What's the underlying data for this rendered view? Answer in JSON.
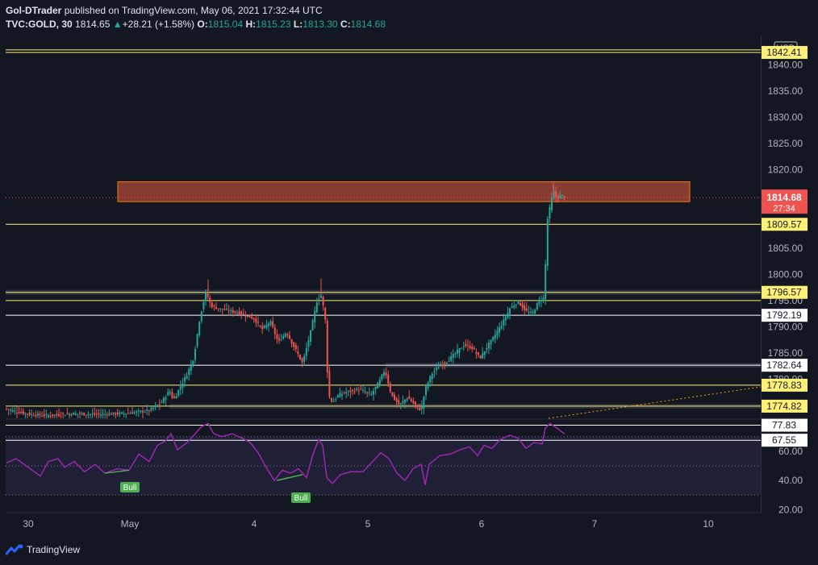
{
  "header": {
    "publisher": "Gol-DTrader",
    "published_text": "published on TradingView.com, May 06, 2021 17:32:44 UTC",
    "symbol": "TVC:GOLD, 30",
    "last": "1814.65",
    "change_arrow": "▲",
    "change": "+28.21 (+1.58%)",
    "open_label": "O:",
    "open": "1815.04",
    "high_label": "H:",
    "high": "1815.23",
    "low_label": "L:",
    "low": "1813.30",
    "close_label": "C:",
    "close": "1814.68"
  },
  "brand": {
    "name": "TradingView",
    "icon": "tradingview-logo-icon"
  },
  "colors": {
    "background": "#131722",
    "up": "#26a69a",
    "down": "#ef5350",
    "level_yellow": "#fff176",
    "level_white": "#ffffff",
    "rsi": "#9c27b0",
    "zone_fill": "#e65b3c",
    "last_price": "#ef5350"
  },
  "chart_data": [
    {
      "type": "candlestick",
      "currency_label": "USD",
      "y_ticks": [
        "1840.00",
        "1835.00",
        "1830.00",
        "1825.00",
        "1820.00",
        "1805.00",
        "1800.00",
        "1795.00",
        "1790.00",
        "1785.00",
        "1780.00"
      ],
      "y_range": [
        1772.5,
        1845.5
      ],
      "x_ticks": [
        "30",
        "May",
        "4",
        "5",
        "6",
        "7",
        "10"
      ],
      "last_price": {
        "value": "1814.68",
        "countdown": "27:34"
      },
      "levels": [
        {
          "value": 1842.41,
          "label": "1842.41",
          "color": "yellow"
        },
        {
          "value": 1809.57,
          "label": "1809.57",
          "color": "yellow"
        },
        {
          "value": 1796.57,
          "label": "1796.57",
          "color": "yellow"
        },
        {
          "value": 1792.19,
          "label": "1792.19",
          "color": "white"
        },
        {
          "value": 1782.64,
          "label": "1782.64",
          "color": "white"
        },
        {
          "value": 1778.83,
          "label": "1778.83",
          "color": "yellow"
        },
        {
          "value": 1774.82,
          "label": "1774.82",
          "color": "yellow"
        }
      ],
      "resistance_zone": [
        1813.9,
        1817.7
      ],
      "price_path": [
        [
          0,
          1774.6
        ],
        [
          10,
          1774.2
        ],
        [
          20,
          1773.8
        ],
        [
          40,
          1773.2
        ],
        [
          60,
          1773.0
        ],
        [
          90,
          1773.4
        ],
        [
          120,
          1773.2
        ],
        [
          160,
          1773.5
        ],
        [
          185,
          1774.0
        ],
        [
          200,
          1775.5
        ],
        [
          210,
          1777.8
        ],
        [
          215,
          1776.0
        ],
        [
          225,
          1779.0
        ],
        [
          232,
          1781.0
        ],
        [
          240,
          1784.0
        ],
        [
          248,
          1792.0
        ],
        [
          255,
          1796.5
        ],
        [
          262,
          1794.0
        ],
        [
          270,
          1793.5
        ],
        [
          285,
          1793.0
        ],
        [
          300,
          1792.5
        ],
        [
          315,
          1791.5
        ],
        [
          325,
          1789.5
        ],
        [
          335,
          1791.0
        ],
        [
          345,
          1787.0
        ],
        [
          355,
          1789.0
        ],
        [
          365,
          1786.0
        ],
        [
          375,
          1783.0
        ],
        [
          385,
          1789.0
        ],
        [
          393,
          1795.0
        ],
        [
          398,
          1796.0
        ],
        [
          403,
          1792.0
        ],
        [
          407,
          1777.0
        ],
        [
          412,
          1775.5
        ],
        [
          420,
          1777.0
        ],
        [
          430,
          1777.5
        ],
        [
          445,
          1778.0
        ],
        [
          460,
          1777.0
        ],
        [
          470,
          1779.5
        ],
        [
          477,
          1781.8
        ],
        [
          485,
          1777.0
        ],
        [
          495,
          1775.0
        ],
        [
          505,
          1776.5
        ],
        [
          515,
          1775.0
        ],
        [
          522,
          1774.0
        ],
        [
          527,
          1778.0
        ],
        [
          535,
          1781.0
        ],
        [
          545,
          1782.5
        ],
        [
          555,
          1783.5
        ],
        [
          565,
          1785.0
        ],
        [
          575,
          1786.5
        ],
        [
          585,
          1786.0
        ],
        [
          595,
          1784.0
        ],
        [
          603,
          1786.0
        ],
        [
          612,
          1788.0
        ],
        [
          622,
          1790.5
        ],
        [
          632,
          1793.5
        ],
        [
          642,
          1794.8
        ],
        [
          652,
          1793.0
        ],
        [
          660,
          1792.5
        ],
        [
          668,
          1795.0
        ],
        [
          674,
          1795.5
        ],
        [
          676,
          1801.0
        ],
        [
          678,
          1810.0
        ],
        [
          682,
          1813.0
        ],
        [
          686,
          1816.0
        ],
        [
          690,
          1814.5
        ],
        [
          696,
          1815.2
        ],
        [
          700,
          1814.68
        ]
      ],
      "dotted_trendline": "orange",
      "series": [
        {
          "name": "TVC:GOLD",
          "type": "candlestick"
        }
      ]
    },
    {
      "type": "line",
      "indicator": "RSI",
      "y_ticks": [
        "60.00",
        "40.00",
        "20.00"
      ],
      "y_range": [
        18,
        82
      ],
      "levels": [
        {
          "value": 77.83,
          "label": "77.83"
        },
        {
          "value": 67.55,
          "label": "67.55"
        }
      ],
      "band": [
        30,
        70
      ],
      "annotations": [
        "Bull",
        "Bull"
      ],
      "rsi_path": [
        [
          8,
          52
        ],
        [
          20,
          55
        ],
        [
          35,
          49
        ],
        [
          50,
          43
        ],
        [
          60,
          53
        ],
        [
          72,
          55
        ],
        [
          80,
          49
        ],
        [
          92,
          53
        ],
        [
          105,
          46
        ],
        [
          118,
          51
        ],
        [
          130,
          45
        ],
        [
          145,
          48
        ],
        [
          160,
          47
        ],
        [
          172,
          58
        ],
        [
          185,
          53
        ],
        [
          195,
          64
        ],
        [
          205,
          67
        ],
        [
          212,
          72
        ],
        [
          220,
          61
        ],
        [
          232,
          66
        ],
        [
          242,
          72
        ],
        [
          250,
          77
        ],
        [
          258,
          79
        ],
        [
          265,
          72
        ],
        [
          275,
          70
        ],
        [
          288,
          72
        ],
        [
          300,
          69
        ],
        [
          310,
          66
        ],
        [
          320,
          59
        ],
        [
          330,
          49
        ],
        [
          340,
          40
        ],
        [
          350,
          47
        ],
        [
          360,
          45
        ],
        [
          370,
          48
        ],
        [
          380,
          42
        ],
        [
          388,
          58
        ],
        [
          395,
          68
        ],
        [
          400,
          64
        ],
        [
          405,
          42
        ],
        [
          412,
          38
        ],
        [
          422,
          44
        ],
        [
          435,
          46
        ],
        [
          450,
          46
        ],
        [
          462,
          53
        ],
        [
          472,
          59
        ],
        [
          482,
          55
        ],
        [
          492,
          45
        ],
        [
          502,
          40
        ],
        [
          512,
          48
        ],
        [
          522,
          51
        ],
        [
          527,
          37
        ],
        [
          532,
          51
        ],
        [
          545,
          57
        ],
        [
          558,
          58
        ],
        [
          570,
          61
        ],
        [
          582,
          63
        ],
        [
          592,
          57
        ],
        [
          600,
          64
        ],
        [
          610,
          62
        ],
        [
          620,
          68
        ],
        [
          632,
          71
        ],
        [
          642,
          69
        ],
        [
          652,
          62
        ],
        [
          662,
          66
        ],
        [
          672,
          65
        ],
        [
          676,
          76
        ],
        [
          682,
          79
        ],
        [
          690,
          76
        ],
        [
          697,
          73
        ],
        [
          700,
          72
        ]
      ]
    }
  ]
}
